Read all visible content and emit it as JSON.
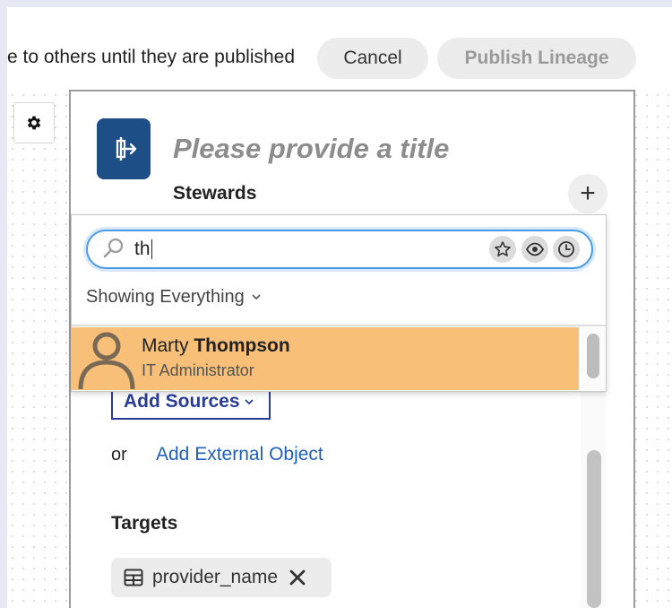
{
  "header": {
    "notice": "e to others until they are published",
    "cancel_label": "Cancel",
    "publish_label": "Publish Lineage"
  },
  "editor": {
    "title_placeholder": "Please provide a title",
    "stewards_label": "Stewards",
    "add_steward_symbol": "+",
    "add_sources_label": "Add Sources",
    "or_text": "or",
    "add_external_label": "Add External Object",
    "targets_label": "Targets",
    "target_chip_label": "provider_name"
  },
  "steward_search": {
    "query": "th",
    "filter_label": "Showing Everything",
    "filter_icons": [
      "star-icon",
      "eye-icon",
      "clock-icon"
    ],
    "results": [
      {
        "name_prefix": "Marty ",
        "name_match": "Thompson",
        "role": "IT Administrator"
      }
    ]
  },
  "colors": {
    "brand": "#1d4f86",
    "highlight": "#f7bf77",
    "link": "#1f5fbf",
    "focus": "#4a9be3"
  }
}
